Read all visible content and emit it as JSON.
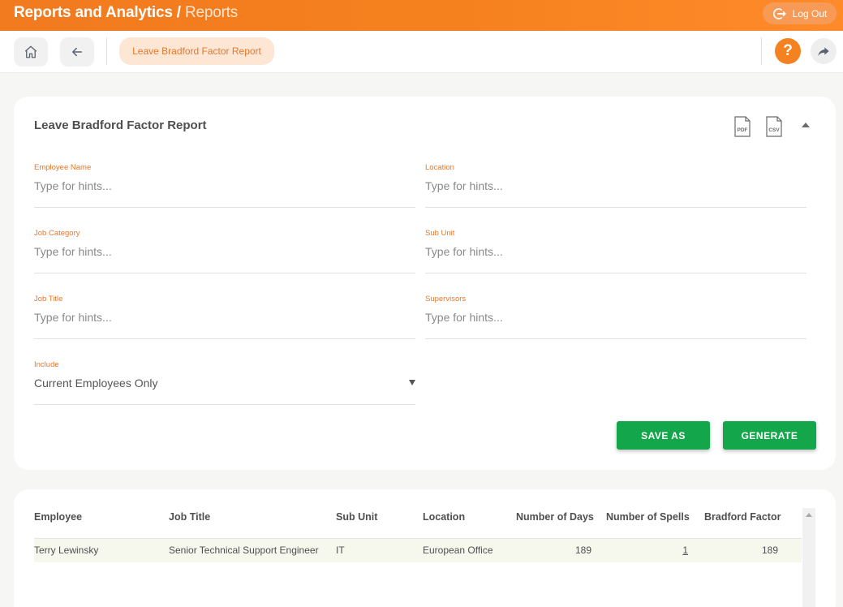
{
  "header": {
    "module": "Reports and Analytics",
    "separator": "/",
    "crumb": "Reports",
    "logout_label": "Log Out"
  },
  "toolbar": {
    "home_icon": "home-icon",
    "back_icon": "arrow-left-icon",
    "active_chip": "Leave Bradford Factor Report",
    "help_label": "?",
    "share_icon": "share-arrow-icon"
  },
  "report": {
    "title": "Leave Bradford Factor Report",
    "pdf_label": "PDF",
    "csv_label": "CSV",
    "fields": {
      "employee_name": {
        "label": "Employee Name",
        "placeholder": "Type for hints..."
      },
      "location": {
        "label": "Location",
        "placeholder": "Type for hints..."
      },
      "job_category": {
        "label": "Job Category",
        "placeholder": "Type for hints..."
      },
      "sub_unit": {
        "label": "Sub Unit",
        "placeholder": "Type for hints..."
      },
      "job_title": {
        "label": "Job Title",
        "placeholder": "Type for hints..."
      },
      "supervisors": {
        "label": "Supervisors",
        "placeholder": "Type for hints..."
      },
      "include": {
        "label": "Include",
        "value": "Current Employees Only"
      }
    },
    "save_as_label": "SAVE AS",
    "generate_label": "GENERATE"
  },
  "results": {
    "columns": [
      "Employee",
      "Job Title",
      "Sub Unit",
      "Location",
      "Number of Days",
      "Number of Spells",
      "Bradford Factor"
    ],
    "rows": [
      {
        "employee": "Terry Lewinsky",
        "job_title": "Senior Technical Support Engineer",
        "sub_unit": "IT",
        "location": "European Office",
        "days": "189",
        "spells": "1",
        "bradford": "189"
      }
    ]
  },
  "colors": {
    "brand_orange": "#f5811e",
    "accent_green": "#13a64b",
    "chip_bg": "#fde6d4"
  }
}
